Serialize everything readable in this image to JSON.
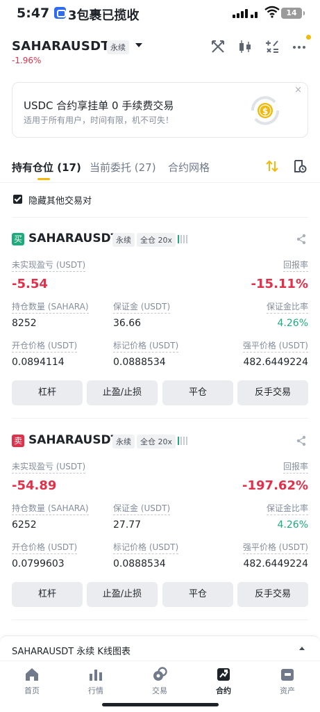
{
  "status_bar": {
    "time": "5:47",
    "app_label": "3包裹已揽收",
    "battery": "14"
  },
  "header": {
    "symbol": "SAHARAUSDT",
    "contract_type": "永续",
    "change": "-1.96%",
    "icons": [
      "swords-icon",
      "candlestick-icon",
      "calculator-icon",
      "more-icon"
    ]
  },
  "banner": {
    "title": "USDC 合约享挂单 0 手续费交易",
    "subtitle": "适用于所有用户，时间有限，机不可失！",
    "close": "×"
  },
  "tabs": [
    {
      "label": "持有仓位 (17)",
      "active": true
    },
    {
      "label": "当前委托 (27)",
      "active": false
    },
    {
      "label": "合约网格",
      "active": false
    }
  ],
  "hide_other_pairs": {
    "label": "隐藏其他交易对",
    "checked": true
  },
  "field_labels": {
    "unrealized_pnl": "未实现盈亏 (USDT)",
    "roe": "回报率",
    "size": "持仓数量 (SAHARA)",
    "margin": "保证金 (USDT)",
    "margin_ratio": "保证金比率",
    "entry_price": "开仓价格 (USDT)",
    "mark_price": "标记价格 (USDT)",
    "liq_price": "强平价格 (USDT)"
  },
  "buttons": {
    "leverage": "杠杆",
    "tp_sl": "止盈/止损",
    "close": "平仓",
    "reverse": "反手交易"
  },
  "positions": [
    {
      "side": "买",
      "symbol": "SAHARAUSDT",
      "contract_type": "永续",
      "margin_mode": "全仓 20x",
      "unrealized_pnl": "-5.54",
      "roe": "-15.11%",
      "size": "8252",
      "margin": "36.66",
      "margin_ratio": "4.26%",
      "entry_price": "0.0894114",
      "mark_price": "0.0888534",
      "liq_price": "482.6449224"
    },
    {
      "side": "卖",
      "symbol": "SAHARAUSDT",
      "contract_type": "永续",
      "margin_mode": "全仓 20x",
      "unrealized_pnl": "-54.89",
      "roe": "-197.62%",
      "size": "6252",
      "margin": "27.77",
      "margin_ratio": "4.26%",
      "entry_price": "0.0799603",
      "mark_price": "0.0888534",
      "liq_price": "482.6449224"
    }
  ],
  "kline_bar": {
    "label": "SAHARAUSDT 永续 K线图表"
  },
  "nav": [
    {
      "label": "首页",
      "icon": "home-icon",
      "active": false
    },
    {
      "label": "行情",
      "icon": "bar-chart-icon",
      "active": false
    },
    {
      "label": "交易",
      "icon": "trade-icon",
      "active": false
    },
    {
      "label": "合约",
      "icon": "futures-icon",
      "active": true
    },
    {
      "label": "资产",
      "icon": "wallet-icon",
      "active": false
    }
  ],
  "colors": {
    "accent": "#f0b90b",
    "up": "#1dab7c",
    "down": "#e0304a"
  }
}
